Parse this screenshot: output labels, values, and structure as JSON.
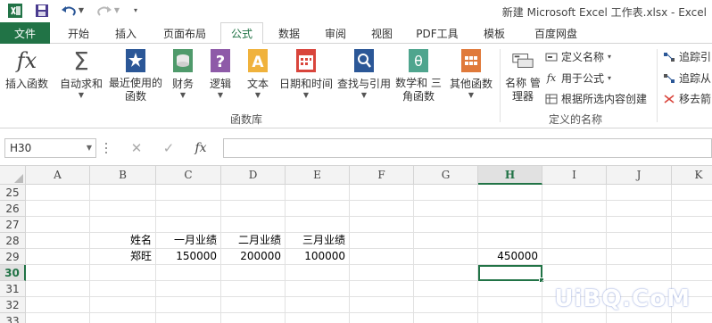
{
  "window": {
    "title": "新建 Microsoft Excel 工作表.xlsx - Excel"
  },
  "tabs": [
    "开始",
    "插入",
    "页面布局",
    "公式",
    "数据",
    "审阅",
    "视图",
    "PDF工具",
    "模板",
    "百度网盘"
  ],
  "file_tab": "文件",
  "active_tab": "公式",
  "ribbon": {
    "function_library": {
      "label": "函数库",
      "buttons": [
        "插入函数",
        "自动求和",
        "最近使用的 函数",
        "财务",
        "逻辑",
        "文本",
        "日期和时间",
        "查找与引用",
        "数学和 三角函数",
        "其他函数"
      ]
    },
    "defined_names": {
      "label": "定义的名称",
      "name_manager": "名称 管理器",
      "define_name": "定义名称",
      "use_in_formula": "用于公式",
      "create_from_selection": "根据所选内容创建"
    },
    "formula_auditing": {
      "trace_precedents": "追踪引",
      "trace_dependents": "追踪从",
      "remove_arrows": "移去箭"
    }
  },
  "formula_bar": {
    "name_box": "H30",
    "formula": ""
  },
  "grid": {
    "columns": [
      "A",
      "B",
      "C",
      "D",
      "E",
      "F",
      "G",
      "H",
      "I",
      "J",
      "K"
    ],
    "selected_column": "H",
    "selected_row": "30",
    "rows": [
      {
        "num": "25",
        "cells": {}
      },
      {
        "num": "26",
        "cells": {}
      },
      {
        "num": "27",
        "cells": {}
      },
      {
        "num": "28",
        "cells": {
          "B": "姓名",
          "C": "一月业绩",
          "D": "二月业绩",
          "E": "三月业绩"
        }
      },
      {
        "num": "29",
        "cells": {
          "B": "郑旺",
          "C": "150000",
          "D": "200000",
          "E": "100000",
          "H": "450000"
        }
      },
      {
        "num": "30",
        "cells": {}
      },
      {
        "num": "31",
        "cells": {}
      },
      {
        "num": "32",
        "cells": {}
      },
      {
        "num": "33",
        "cells": {}
      }
    ]
  },
  "watermark": "UiBQ.CoM",
  "colors": {
    "accent": "#217346",
    "grid_line": "#e1e1e1",
    "header_bg": "#f3f3f3"
  }
}
